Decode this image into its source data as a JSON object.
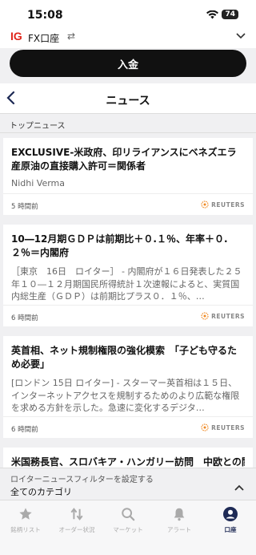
{
  "status": {
    "time": "15:08",
    "battery": "74"
  },
  "account": {
    "logo": "IG",
    "name": "FX口座"
  },
  "deposit": {
    "label": "入金"
  },
  "nav": {
    "title": "ニュース"
  },
  "section": {
    "title": "トップニュース"
  },
  "news": [
    {
      "headline": "EXCLUSIVE-米政府、印リライアンスにベネズエラ産原油の直接購入許可＝関係者",
      "author": "Nidhi Verma",
      "time": "5 時間前",
      "source": "REUTERS"
    },
    {
      "headline": "10―12月期ＧＤＰは前期比＋０.１％、年率＋０.２％＝内閣府",
      "summary": "［東京　16日　ロイター］ - 内閣府が１６日発表した２５年１０―１２月期国民所得統計１次速報によると、実質国内総生産（ＧＤＰ）は前期比プラス０．１％、…",
      "time": "6 時間前",
      "source": "REUTERS"
    },
    {
      "headline": "英首相、ネット規制権限の強化模索　「子ども守るため必要」",
      "summary": "[ロンドン 15日 ロイター] - スターマー英首相は１５日、インターネットアクセスを規制するためのより広範な権限を求める方針を示した。急速に変化するデジタ…",
      "time": "6 時間前",
      "source": "REUTERS"
    },
    {
      "headline": "米国務長官、スロバキア・ハンガリー訪問　中欧との関"
    }
  ],
  "filter": {
    "label": "ロイターニュースフィルターを設定する",
    "value": "全てのカテゴリ"
  },
  "tabs": [
    {
      "label": "銘柄リスト",
      "icon": "star-icon",
      "active": false
    },
    {
      "label": "オーダー状況",
      "icon": "transfer-icon",
      "active": false
    },
    {
      "label": "マーケット",
      "icon": "search-icon",
      "active": false
    },
    {
      "label": "アラート",
      "icon": "bell-icon",
      "active": false
    },
    {
      "label": "口座",
      "icon": "account-icon",
      "active": true
    }
  ],
  "colors": {
    "brand": "#e0261b",
    "active_tab": "#1e2a55",
    "reuters": "#f08a24"
  }
}
